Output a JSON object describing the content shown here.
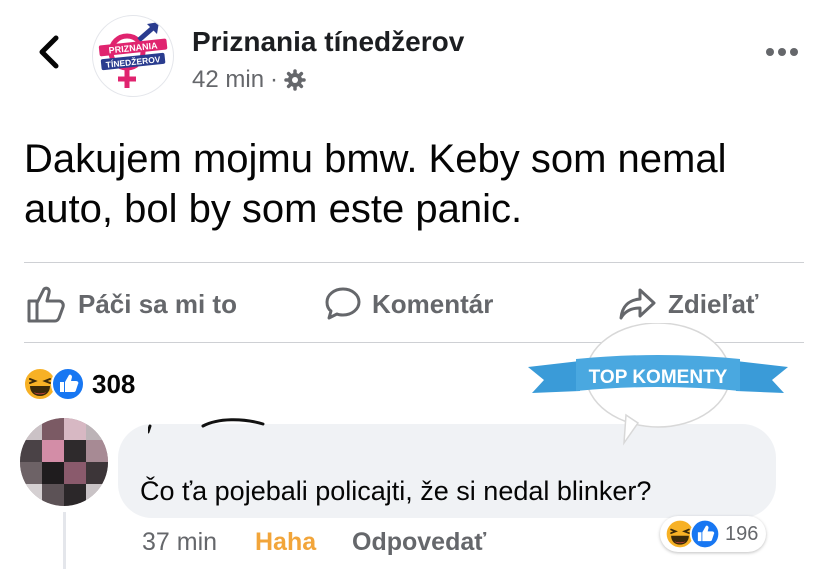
{
  "header": {
    "page_name": "Priznania tínedžerov",
    "time": "42 min",
    "separator": "·",
    "logo_text_line1": "PRIZNANIA",
    "logo_text_line2": "TÍNEDŽEROV"
  },
  "post": {
    "text": "Dakujem mojmu bmw. Keby som nemal auto, bol by som este panic."
  },
  "actions": {
    "like_label": "Páči sa mi to",
    "comment_label": "Komentár",
    "share_label": "Zdieľať"
  },
  "reactions": {
    "count": "308",
    "icons": [
      "haha-icon",
      "like-icon"
    ]
  },
  "top_comments_badge": "TOP KOMENTY",
  "comment": {
    "text": "Čo ťa pojebali policajti, že si nedal blinker?",
    "time": "37 min",
    "reaction_label": "Haha",
    "reply_label": "Odpovedať",
    "reaction_count": "196"
  },
  "colors": {
    "haha_yellow": "#f7b125",
    "like_blue": "#1877f2",
    "meta_gray": "#65676b",
    "bubble_bg": "#f0f2f5",
    "badge_blue": "#3a9bd8",
    "haha_label": "#f2a53a",
    "logo_pink": "#e0246f",
    "logo_blue": "#2a3c8f"
  }
}
